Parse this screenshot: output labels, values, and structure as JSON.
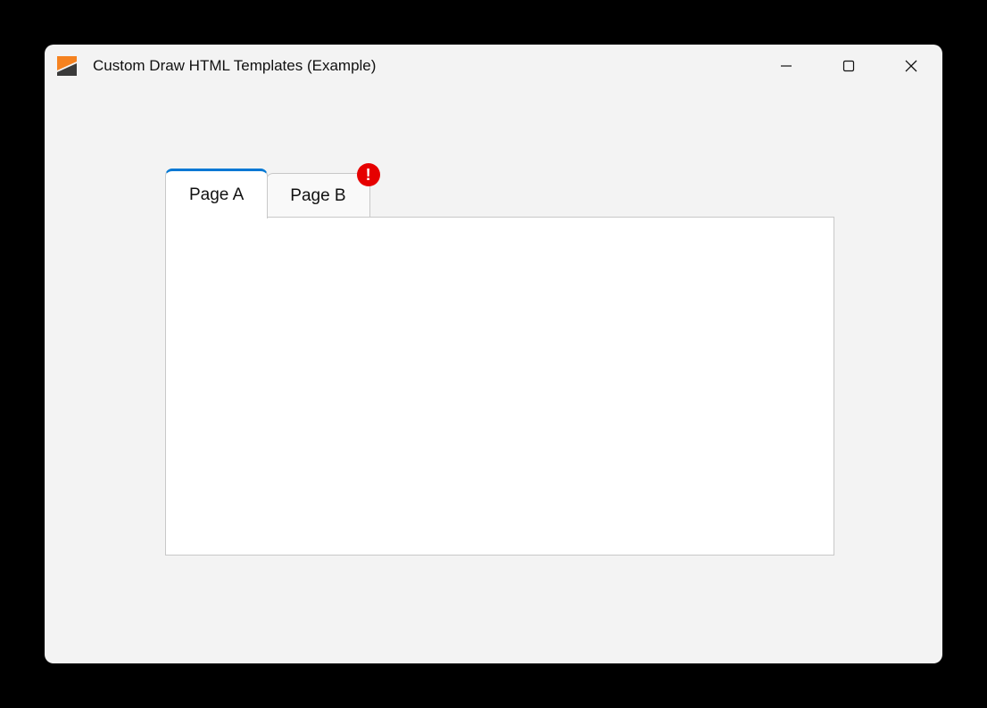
{
  "window": {
    "title": "Custom Draw HTML Templates (Example)"
  },
  "tabs": {
    "items": [
      {
        "label": "Page A",
        "active": true
      },
      {
        "label": "Page B",
        "active": false,
        "badge": "!"
      }
    ]
  }
}
